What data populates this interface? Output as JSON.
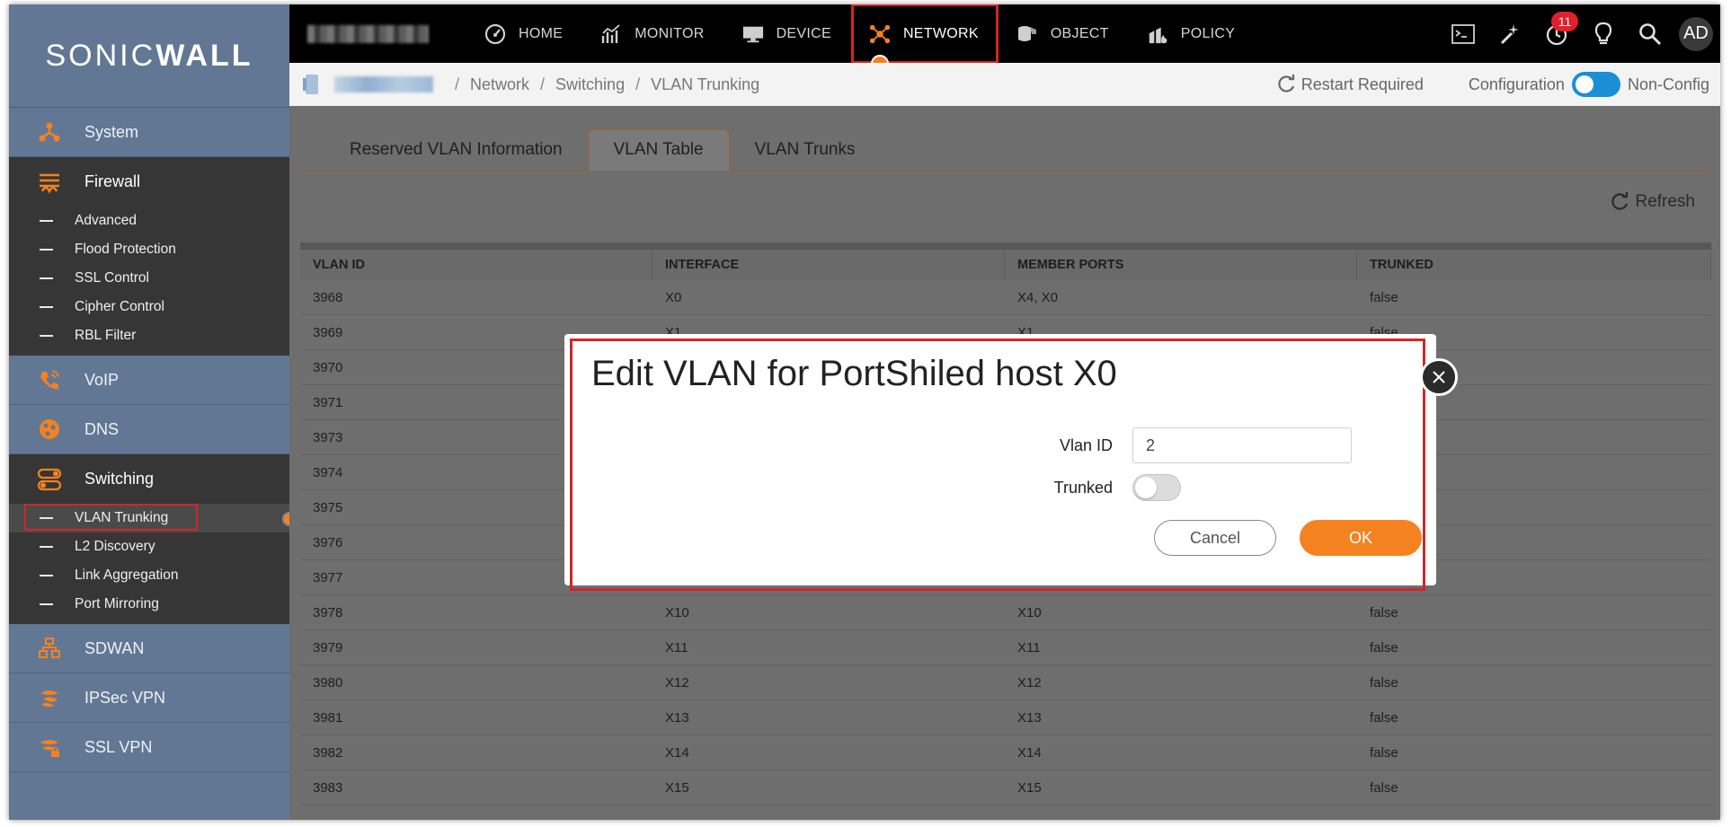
{
  "brand": {
    "logo_left": "SONIC",
    "logo_right": "WALL"
  },
  "sidebar": {
    "sections": [
      {
        "label": "System",
        "icon": "system-icon"
      },
      {
        "label": "Firewall",
        "icon": "firewall-icon"
      },
      {
        "label": "VoIP",
        "icon": "voip-icon"
      },
      {
        "label": "DNS",
        "icon": "dns-icon"
      },
      {
        "label": "Switching",
        "icon": "switching-icon"
      },
      {
        "label": "SDWAN",
        "icon": "sdwan-icon"
      },
      {
        "label": "IPSec VPN",
        "icon": "ipsec-vpn-icon"
      },
      {
        "label": "SSL VPN",
        "icon": "ssl-vpn-icon"
      }
    ],
    "firewall_items": [
      "Advanced",
      "Flood Protection",
      "SSL Control",
      "Cipher Control",
      "RBL Filter"
    ],
    "switching_items": [
      "VLAN Trunking",
      "L2 Discovery",
      "Link Aggregation",
      "Port Mirroring"
    ]
  },
  "topnav": {
    "items": [
      {
        "label": "HOME",
        "icon": "dashboard-gauge-icon"
      },
      {
        "label": "MONITOR",
        "icon": "monitor-chart-icon"
      },
      {
        "label": "DEVICE",
        "icon": "device-screen-icon"
      },
      {
        "label": "NETWORK",
        "icon": "network-hub-icon"
      },
      {
        "label": "OBJECT",
        "icon": "object-cylinder-icon"
      },
      {
        "label": "POLICY",
        "icon": "policy-flame-icon"
      }
    ],
    "active": "NETWORK",
    "badge_count": "11",
    "avatar": "AD"
  },
  "breadcrumb": {
    "items": [
      "Network",
      "Switching",
      "VLAN Trunking"
    ],
    "restart": "Restart Required",
    "config_label": "Configuration",
    "nonconfig_label": "Non-Config"
  },
  "tabs": [
    "Reserved VLAN Information",
    "VLAN Table",
    "VLAN Trunks"
  ],
  "active_tab": "VLAN Table",
  "refresh_label": "Refresh",
  "table": {
    "headers": [
      "VLAN ID",
      "INTERFACE",
      "MEMBER PORTS",
      "TRUNKED"
    ],
    "rows": [
      [
        "3968",
        "X0",
        "X4, X0",
        "false"
      ],
      [
        "3969",
        "X1",
        "X1",
        "false"
      ],
      [
        "3970",
        "",
        "",
        ""
      ],
      [
        "3971",
        "",
        "",
        ""
      ],
      [
        "3973",
        "",
        "",
        ""
      ],
      [
        "3974",
        "",
        "",
        ""
      ],
      [
        "3975",
        "",
        "",
        ""
      ],
      [
        "3976",
        "",
        "",
        ""
      ],
      [
        "3977",
        "",
        "",
        ""
      ],
      [
        "3978",
        "X10",
        "X10",
        "false"
      ],
      [
        "3979",
        "X11",
        "X11",
        "false"
      ],
      [
        "3980",
        "X12",
        "X12",
        "false"
      ],
      [
        "3981",
        "X13",
        "X13",
        "false"
      ],
      [
        "3982",
        "X14",
        "X14",
        "false"
      ],
      [
        "3983",
        "X15",
        "X15",
        "false"
      ]
    ]
  },
  "modal": {
    "title": "Edit VLAN for PortShiled host X0",
    "vlan_label": "Vlan ID",
    "vlan_value": "2",
    "trunked_label": "Trunked",
    "trunked": false,
    "cancel": "Cancel",
    "ok": "OK"
  },
  "colors": {
    "accent": "#f58220",
    "highlight": "#d0262b",
    "sidebar": "#627794",
    "toggle_on": "#1a8ed6"
  }
}
